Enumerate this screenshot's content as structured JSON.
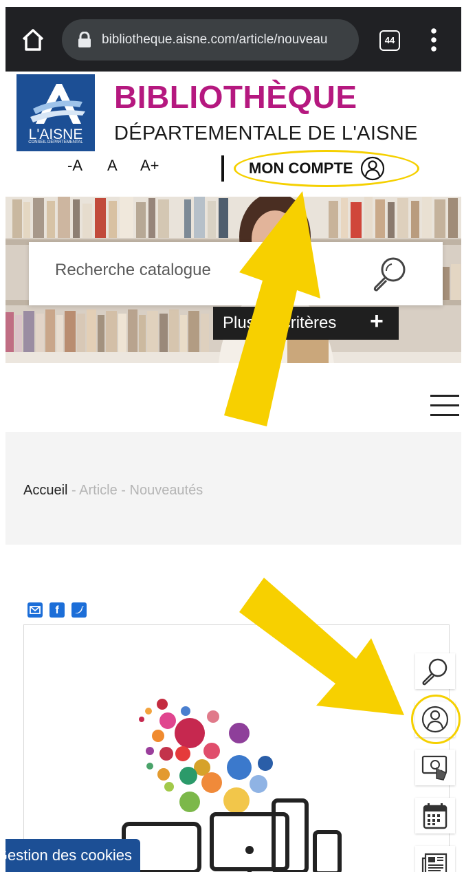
{
  "browser": {
    "url": "bibliotheque.aisne.com/article/nouveau",
    "tab_count": "44"
  },
  "header": {
    "logo_text": "L'AISNE",
    "logo_subtext": "CONSEIL DÉPARTEMENTAL",
    "title_line1": "BIBLIOTHÈQUE",
    "title_line2": "DÉPARTEMENTALE DE L'AISNE",
    "font_decrease": "-A",
    "font_normal": "A",
    "font_increase": "A+",
    "account_label": "MON COMPTE"
  },
  "search": {
    "placeholder": "Recherche catalogue",
    "more_criteria_label": "Plus de critères"
  },
  "breadcrumb": {
    "home": "Accueil",
    "rest": "- Article - Nouveautés"
  },
  "cookies": {
    "label": "Gestion des cookies"
  },
  "colors": {
    "brand_magenta": "#b5187f",
    "brand_blue": "#1c4f95",
    "highlight_yellow": "#f5d000"
  },
  "icons": [
    "home-icon",
    "lock-icon",
    "more-vert-icon",
    "user-icon",
    "search-icon",
    "menu-icon",
    "email-icon",
    "facebook-icon",
    "twitter-icon",
    "touch-screen-icon",
    "calendar-icon",
    "newspaper-icon"
  ]
}
